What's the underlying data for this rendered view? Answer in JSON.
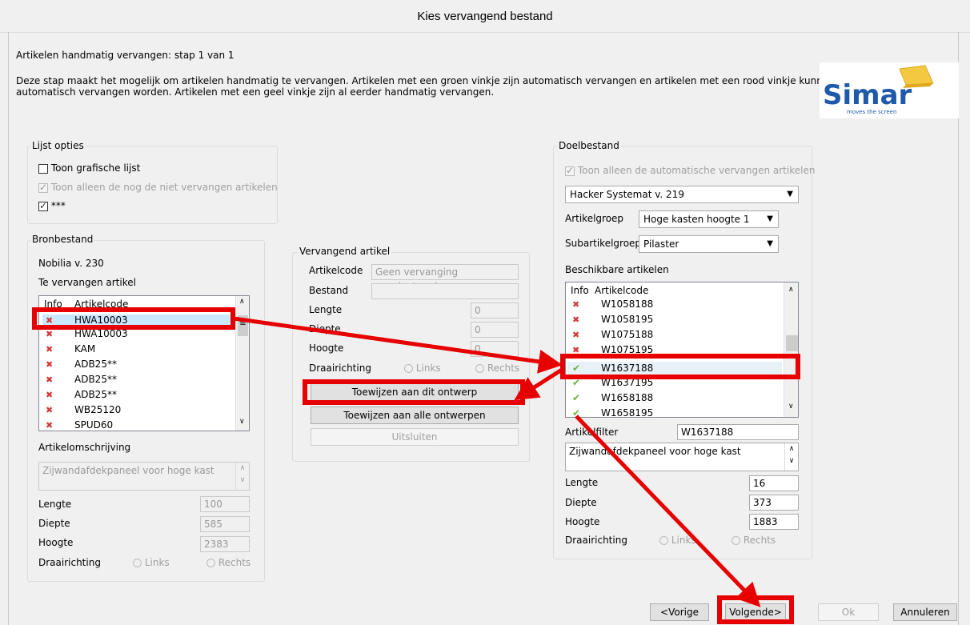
{
  "window": {
    "title": "Kies vervangend bestand"
  },
  "header": {
    "step": "Artikelen handmatig vervangen: stap 1 van 1",
    "desc1": "Deze stap maakt het mogelijk om artikelen handmatig te vervangen. Artikelen met een groen vinkje zijn automatisch vervangen en artikelen met een rood vinkje kunnen niet",
    "desc2": "automatisch vervangen worden. Artikelen met een geel vinkje zijn al eerder handmatig vervangen.",
    "logo_text": "Simar",
    "logo_tagline": "moves the screen"
  },
  "lijst": {
    "legend": "Lijst opties",
    "opt1": "Toon grafische lijst",
    "opt2": "Toon alleen de nog de niet vervangen artikelen",
    "opt3": "***"
  },
  "bron": {
    "legend": "Bronbestand",
    "file": "Nobilia v. 230",
    "te_vervangen": "Te vervangen artikel",
    "col_info": "Info",
    "col_code": "Artikelcode",
    "items": [
      "HWA10003",
      "HWA10003",
      "KAM",
      "ADB25**",
      "ADB25**",
      "ADB25**",
      "WB25120",
      "SPUD60"
    ],
    "omschrijving_label": "Artikelomschrijving",
    "omschrijving": "Zijwandafdekpaneel voor hoge kast",
    "lengte_label": "Lengte",
    "lengte": "100",
    "diepte_label": "Diepte",
    "diepte": "585",
    "hoogte_label": "Hoogte",
    "hoogte": "2383",
    "draai_label": "Draairichting",
    "links": "Links",
    "rechts": "Rechts"
  },
  "vervangend": {
    "legend": "Vervangend artikel",
    "code_label": "Artikelcode",
    "code": "Geen vervanging geselecteerd",
    "bestand_label": "Bestand",
    "bestand": "",
    "lengte_label": "Lengte",
    "lengte": "0",
    "diepte_label": "Diepte",
    "diepte": "0",
    "hoogte_label": "Hoogte",
    "hoogte": "0",
    "draai_label": "Draairichting",
    "links": "Links",
    "rechts": "Rechts",
    "btn_dit": "Toewijzen aan dit ontwerp",
    "btn_alle": "Toewijzen aan alle ontwerpen",
    "btn_uitsluiten": "Uitsluiten"
  },
  "doel": {
    "legend": "Doelbestand",
    "auto_only": "Toon alleen de automatische vervangen artikelen",
    "catalog": "Hacker Systemat  v. 219",
    "groep_label": "Artikelgroep",
    "groep": "Hoge kasten hoogte 1",
    "subgroep_label": "Subartikelgroep",
    "subgroep": "Pilaster",
    "beschikbaar": "Beschikbare artikelen",
    "col_info": "Info",
    "col_code": "Artikelcode",
    "items": [
      {
        "code": "W1058188",
        "status": "x"
      },
      {
        "code": "W1058195",
        "status": "x"
      },
      {
        "code": "W1075188",
        "status": "x"
      },
      {
        "code": "W1075195",
        "status": "x"
      },
      {
        "code": "W1637188",
        "status": "v"
      },
      {
        "code": "W1637195",
        "status": "v"
      },
      {
        "code": "W1658188",
        "status": "v"
      },
      {
        "code": "W1658195",
        "status": "v"
      }
    ],
    "filter_label": "Artikelfilter",
    "filter": "W1637188",
    "omschrijving": "Zijwandafdekpaneel voor hoge kast",
    "lengte_label": "Lengte",
    "lengte": "16",
    "diepte_label": "Diepte",
    "diepte": "373",
    "hoogte_label": "Hoogte",
    "hoogte": "1883",
    "draai_label": "Draairichting",
    "links": "Links",
    "rechts": "Rechts"
  },
  "footer": {
    "vorige": "<Vorige",
    "volgende": "Volgende>",
    "ok": "Ok",
    "annuleren": "Annuleren"
  },
  "annotation": {
    "color": "#e60000"
  }
}
